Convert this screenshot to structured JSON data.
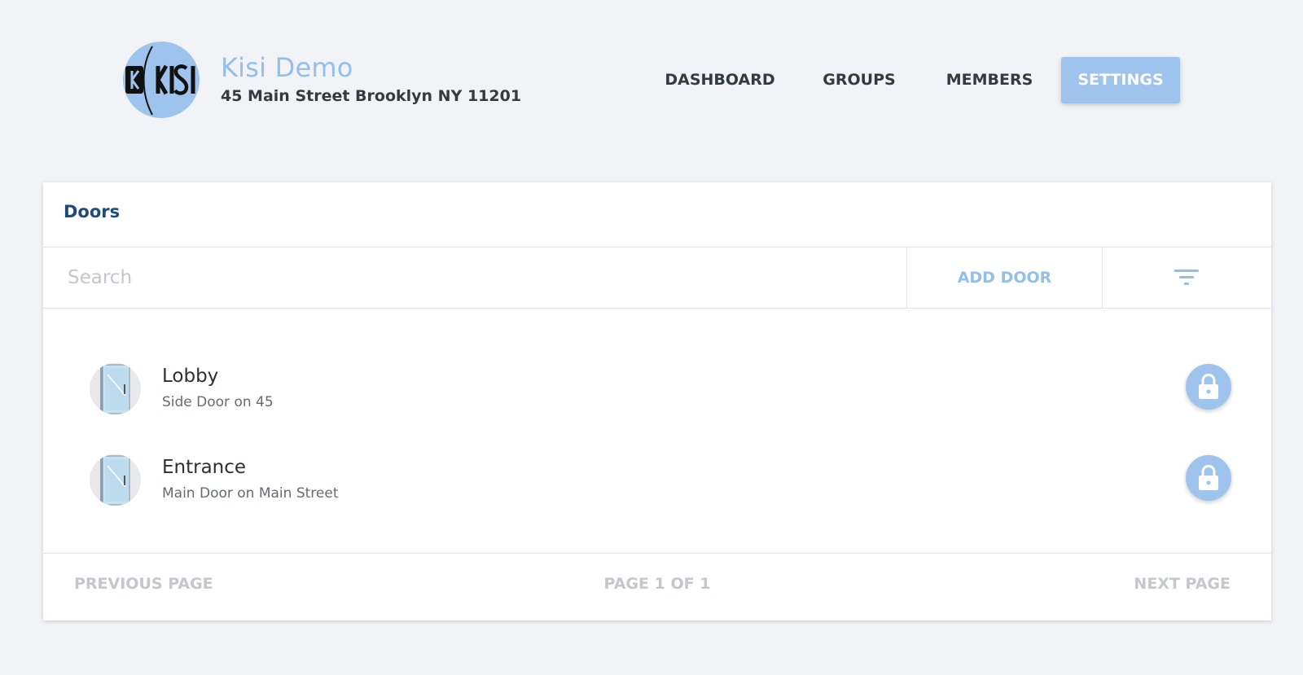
{
  "header": {
    "logo_text": "KISI",
    "org_name": "Kisi Demo",
    "org_address": "45 Main Street Brooklyn NY 11201",
    "nav": [
      {
        "label": "DASHBOARD",
        "active": false
      },
      {
        "label": "GROUPS",
        "active": false
      },
      {
        "label": "MEMBERS",
        "active": false
      },
      {
        "label": "SETTINGS",
        "active": true
      }
    ]
  },
  "doors_panel": {
    "title": "Doors",
    "search": {
      "placeholder": "Search",
      "value": ""
    },
    "add_door_label": "ADD DOOR",
    "filter_icon": "filter-icon",
    "doors": [
      {
        "name": "Lobby",
        "description": "Side Door on 45",
        "icon": "door-icon",
        "action_icon": "lock-icon"
      },
      {
        "name": "Entrance",
        "description": "Main Door on Main Street",
        "icon": "door-icon",
        "action_icon": "lock-icon"
      }
    ],
    "pagination": {
      "previous_label": "PREVIOUS PAGE",
      "page_info": "PAGE 1 OF 1",
      "next_label": "NEXT PAGE"
    }
  },
  "colors": {
    "accent": "#9ec3ec",
    "background": "#f1f3f7",
    "title": "#1f4a7a",
    "text": "#333a44",
    "muted": "#c4c7cc"
  }
}
